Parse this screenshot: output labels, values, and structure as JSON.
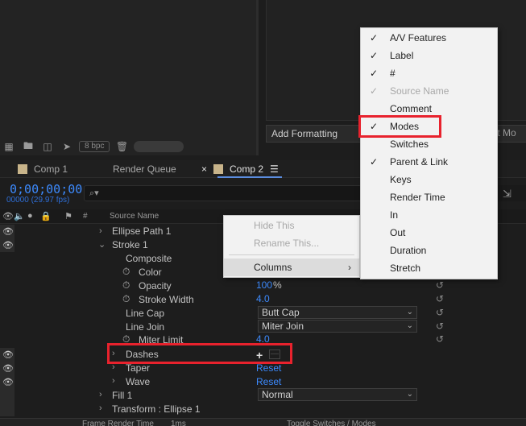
{
  "project_panel": {
    "bpc_label": "8 bpc",
    "toolbar_icons": [
      "interpret-footage-icon",
      "new-folder-icon",
      "new-composition-icon",
      "flowchart-icon",
      "trash-icon"
    ]
  },
  "essential_graphics": {
    "add_formatting_label": "Add Formatting",
    "export_clip_label": "port Mo"
  },
  "tabs": [
    {
      "label": "Comp 1"
    },
    {
      "label": "Render Queue"
    },
    {
      "label": "Comp 2",
      "active": true
    }
  ],
  "timeline": {
    "timecode": "0;00;00;00",
    "fps": "00000 (29.97 fps)",
    "search_placeholder": "⌕▾",
    "header": {
      "hash_label": "#",
      "source_name_label": "Source Name"
    },
    "rows": [
      {
        "label": "Ellipse Path 1"
      },
      {
        "label": "Stroke 1"
      },
      {
        "label": "Composite"
      },
      {
        "label": "Color"
      },
      {
        "label": "Opacity",
        "value": "100",
        "unit": "%"
      },
      {
        "label": "Stroke Width",
        "value": "4.0"
      },
      {
        "label": "Line Cap",
        "dropdown": "Butt Cap"
      },
      {
        "label": "Line Join",
        "dropdown": "Miter Join"
      },
      {
        "label": "Miter Limit",
        "value": "4.0"
      },
      {
        "label": "Dashes",
        "plus": "+",
        "minus": "—"
      },
      {
        "label": "Taper",
        "value": "Reset"
      },
      {
        "label": "Wave",
        "value": "Reset"
      },
      {
        "label": "Fill 1",
        "dropdown": "Normal"
      },
      {
        "label": "Transform : Ellipse 1"
      }
    ],
    "status_left": "Frame Render Time",
    "status_value": "1ms",
    "status_right": "Toggle Switches / Modes"
  },
  "context_menu": {
    "items": [
      {
        "label": "Hide This",
        "disabled": true
      },
      {
        "label": "Rename This...",
        "disabled": true
      },
      {
        "label": "Columns",
        "submenu": true
      }
    ]
  },
  "columns_menu": {
    "items": [
      {
        "label": "A/V Features",
        "checked": true
      },
      {
        "label": "Label",
        "checked": true
      },
      {
        "label": "#",
        "checked": true
      },
      {
        "label": "Source Name",
        "checked": true,
        "disabled": true
      },
      {
        "label": "Comment",
        "checked": false
      },
      {
        "label": "Modes",
        "checked": true
      },
      {
        "label": "Switches",
        "checked": false
      },
      {
        "label": "Parent & Link",
        "checked": true
      },
      {
        "label": "Keys",
        "checked": false
      },
      {
        "label": "Render Time",
        "checked": false
      },
      {
        "label": "In",
        "checked": false
      },
      {
        "label": "Out",
        "checked": false
      },
      {
        "label": "Duration",
        "checked": false
      },
      {
        "label": "Stretch",
        "checked": false
      }
    ]
  },
  "colors": {
    "accent_blue": "#3d8bff",
    "highlight_red": "#e8222d",
    "label_swatch": "#c8b48a"
  }
}
